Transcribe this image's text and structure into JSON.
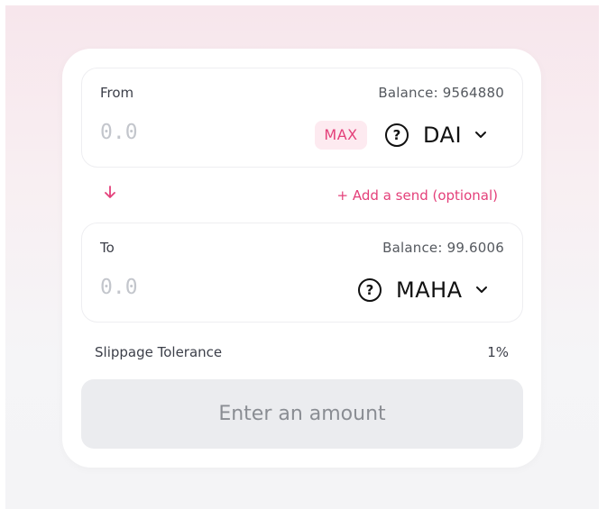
{
  "from": {
    "label": "From",
    "balance": "Balance: 9564880",
    "amount_placeholder": "0.0",
    "max_label": "MAX",
    "token": "DAI"
  },
  "swap": {
    "add_send_label": "+ Add a send (optional)"
  },
  "to": {
    "label": "To",
    "balance": "Balance: 99.6006",
    "amount_placeholder": "0.0",
    "token": "MAHA"
  },
  "slippage": {
    "label": "Slippage Tolerance",
    "value": "1%"
  },
  "submit_label": "Enter an amount",
  "icons": {
    "token_unknown": "question-circle-icon",
    "dropdown": "chevron-down-icon",
    "swap_direction": "arrow-down-icon"
  },
  "colors": {
    "accent": "#e4407a",
    "max_bg": "#fdeaf0",
    "disabled_button_bg": "#ebecef"
  }
}
